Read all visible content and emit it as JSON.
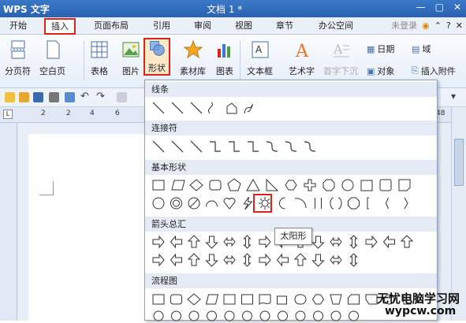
{
  "titlebar": {
    "app": "WPS 文字",
    "document": "文档 1 *"
  },
  "menu": {
    "tabs": [
      "开始",
      "插入",
      "页面布局",
      "引用",
      "审阅",
      "视图",
      "章节",
      "办公空间"
    ],
    "login": "未登录"
  },
  "ribbon": {
    "page_break": "分页符",
    "blank_page": "空白页",
    "table": "表格",
    "picture": "图片",
    "shape": "形状",
    "material": "素材库",
    "chart": "图表",
    "textbox": "文本框",
    "wordart": "艺术字",
    "drop_cap": "首字下沉",
    "date": "日期",
    "field": "域",
    "object": "对象",
    "attach": "插入附件"
  },
  "ruler": {
    "marks": [
      "2",
      "2",
      "4",
      "6",
      "48"
    ]
  },
  "popup": {
    "sections": [
      "线条",
      "连接符",
      "基本形状",
      "箭头总汇",
      "流程图"
    ]
  },
  "tooltip": "太阳形",
  "watermark": {
    "line1": "无忧电脑学习网",
    "line2": "wypcw.com"
  },
  "colors": {
    "accent_red": "#d9241c",
    "title_blue": "#2a62b0"
  }
}
